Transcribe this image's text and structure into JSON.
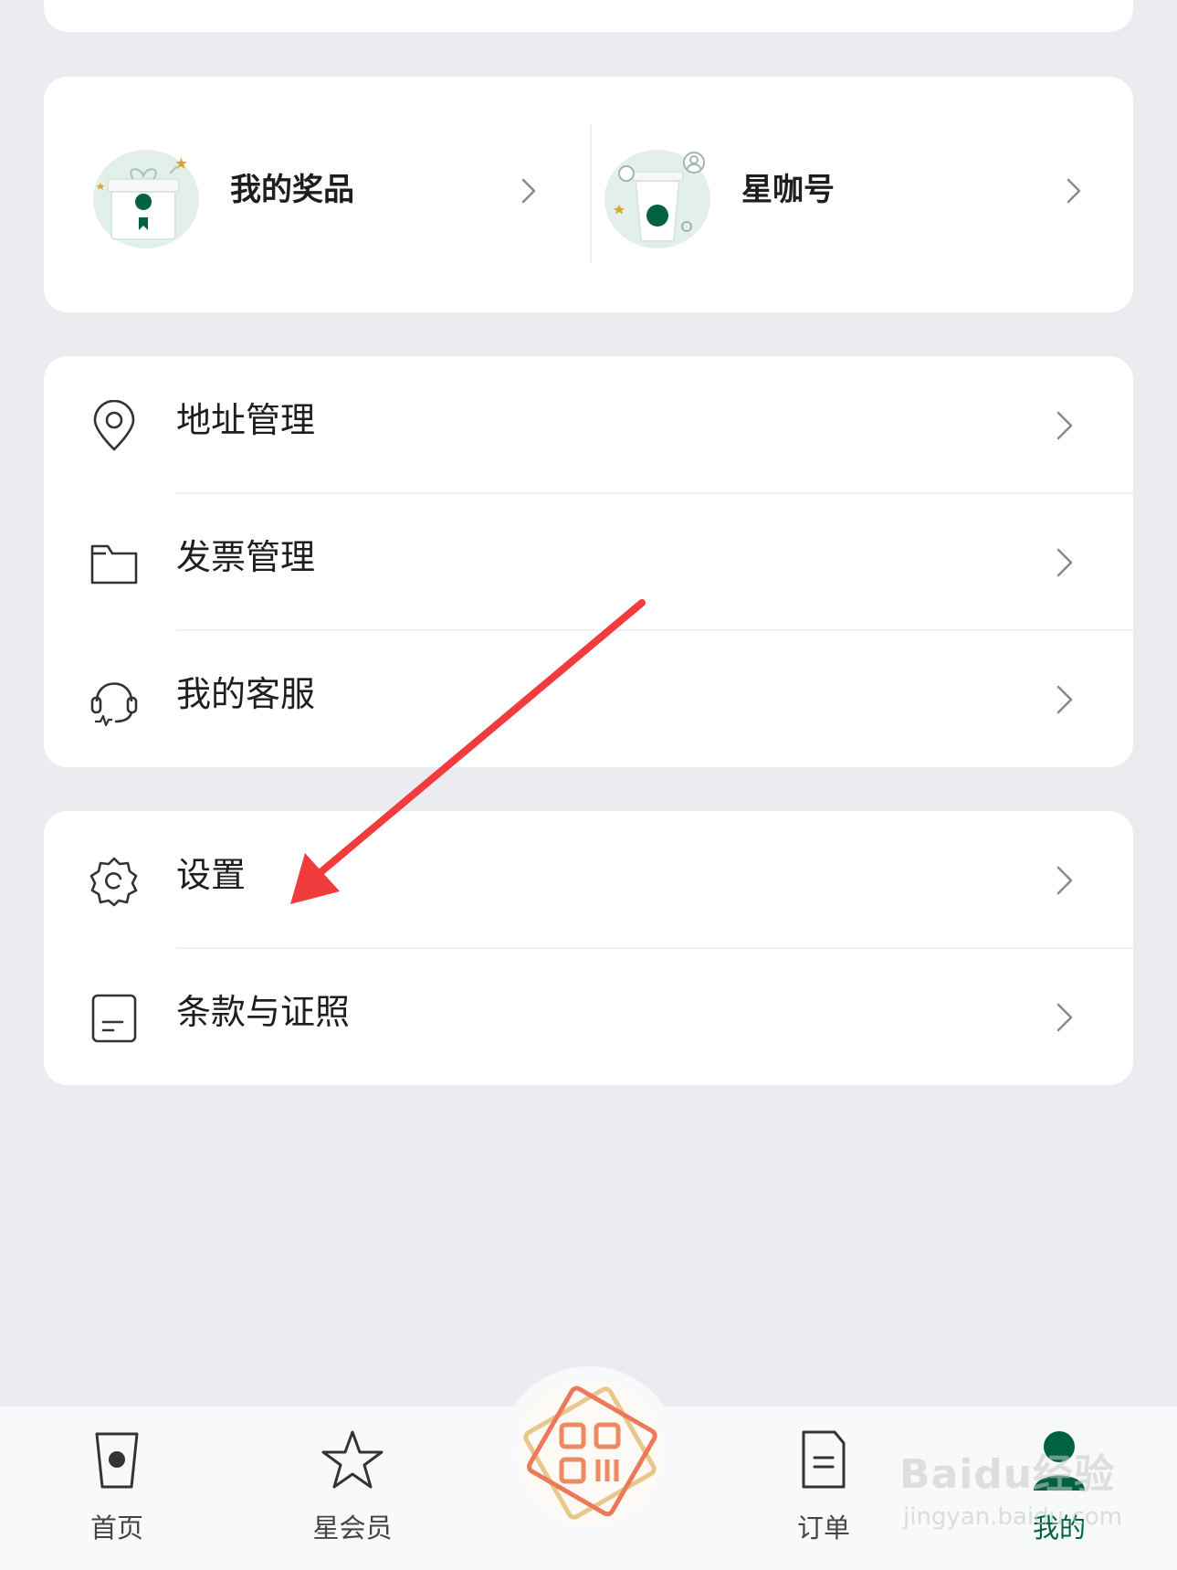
{
  "rewards": {
    "items": [
      {
        "label": "我的奖品"
      },
      {
        "label": "星咖号"
      }
    ]
  },
  "services": {
    "items": [
      {
        "label": "地址管理",
        "icon": "location-pin-icon"
      },
      {
        "label": "发票管理",
        "icon": "folder-icon"
      },
      {
        "label": "我的客服",
        "icon": "headset-icon"
      }
    ]
  },
  "settings": {
    "items": [
      {
        "label": "设置",
        "icon": "gear-icon"
      },
      {
        "label": "条款与证照",
        "icon": "document-icon"
      }
    ]
  },
  "tabbar": {
    "items": [
      {
        "label": "首页",
        "icon": "cup-icon",
        "active": false
      },
      {
        "label": "星会员",
        "icon": "star-icon",
        "active": false
      },
      {
        "label": "",
        "icon": "qr-scan-icon",
        "active": false
      },
      {
        "label": "订单",
        "icon": "order-icon",
        "active": false
      },
      {
        "label": "我的",
        "icon": "person-icon",
        "active": true
      }
    ]
  },
  "watermark": {
    "brand": "Baidu经验",
    "url": "jingyan.baidu.com"
  },
  "annotation": {
    "type": "red-arrow",
    "target": "设置"
  },
  "colors": {
    "background": "#ebecef",
    "card": "#ffffff",
    "brand_green": "#006241",
    "arrow_red": "#f03c3c",
    "text": "#1e1e1e"
  }
}
